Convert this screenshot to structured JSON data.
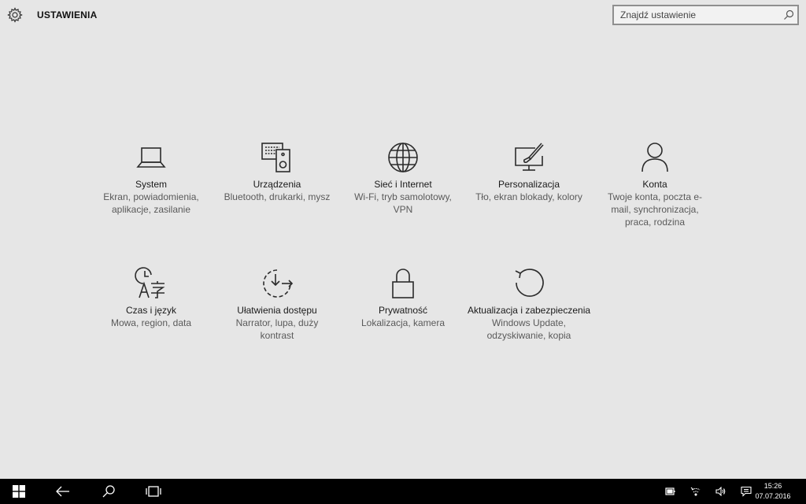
{
  "header": {
    "title": "USTAWIENIA",
    "search_placeholder": "Znajdź ustawienie"
  },
  "categories": [
    {
      "name": "System",
      "desc": "Ekran, powiadomienia, aplikacje, zasilanie",
      "icon": "laptop-icon"
    },
    {
      "name": "Urządzenia",
      "desc": "Bluetooth, drukarki, mysz",
      "icon": "devices-icon"
    },
    {
      "name": "Sieć i Internet",
      "desc": "Wi-Fi, tryb samolotowy, VPN",
      "icon": "globe-icon"
    },
    {
      "name": "Personalizacja",
      "desc": "Tło, ekran blokady, kolory",
      "icon": "paintbrush-icon"
    },
    {
      "name": "Konta",
      "desc": "Twoje konta, poczta e-mail, synchronizacja, praca, rodzina",
      "icon": "person-icon"
    },
    {
      "name": "Czas i język",
      "desc": "Mowa, region, data",
      "icon": "time-language-icon"
    },
    {
      "name": "Ułatwienia dostępu",
      "desc": "Narrator, lupa, duży kontrast",
      "icon": "ease-of-access-icon"
    },
    {
      "name": "Prywatność",
      "desc": "Lokalizacja, kamera",
      "icon": "lock-icon"
    },
    {
      "name": "Aktualizacja i zabezpieczenia",
      "desc": "Windows Update, odzyskiwanie, kopia",
      "icon": "update-icon"
    }
  ],
  "taskbar": {
    "time": "15:26",
    "date": "07.07.2016"
  },
  "colors": {
    "background": "#e6e6e6",
    "taskbar": "#000000",
    "text_primary": "#1a1a1a",
    "text_secondary": "#5a5a5a"
  }
}
